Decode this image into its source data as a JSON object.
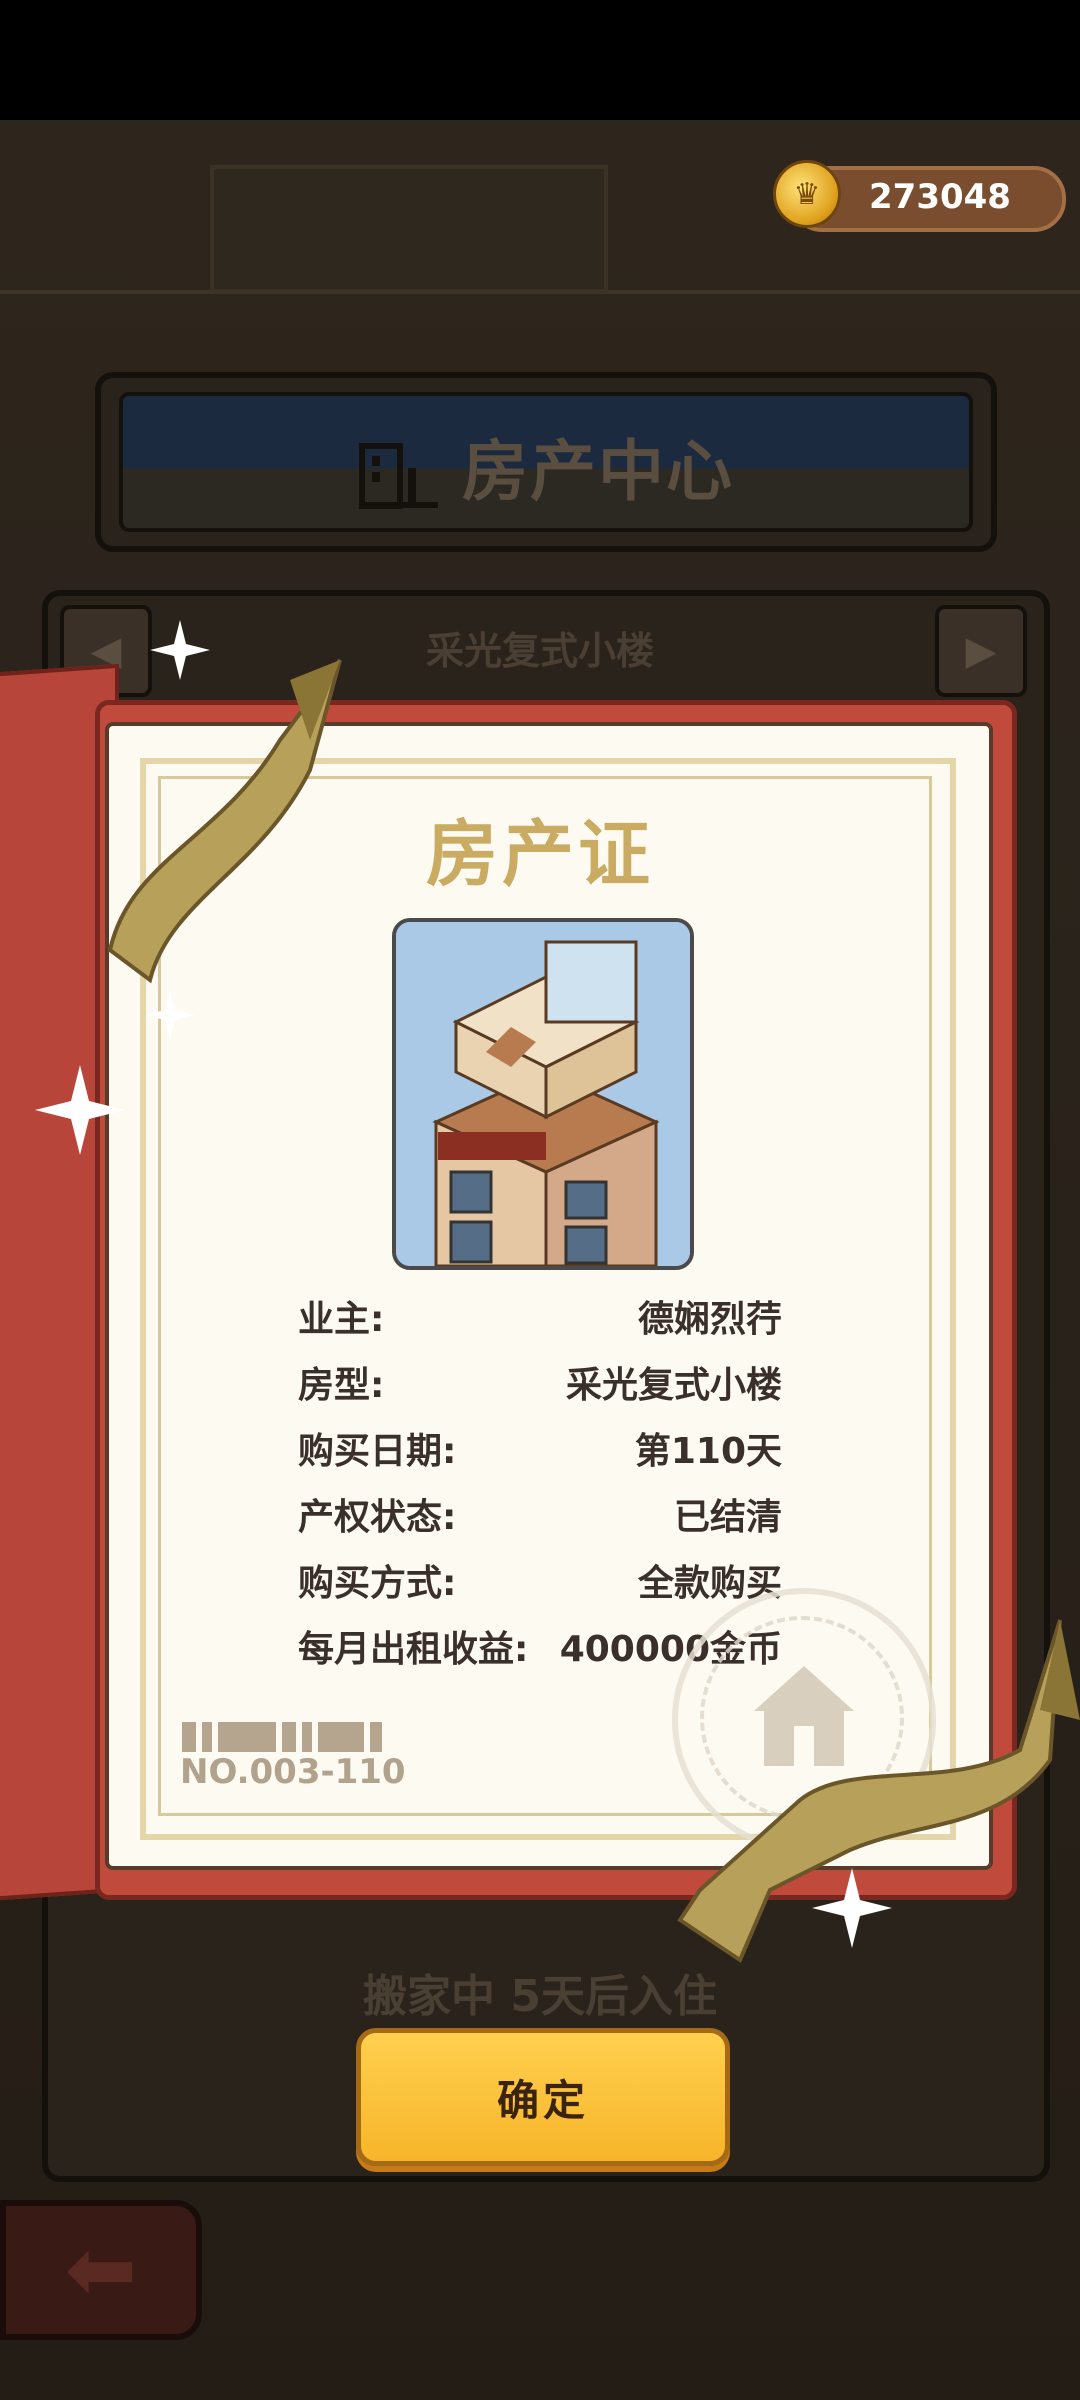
{
  "coins": {
    "value": "273048",
    "icon": "crown-coin-icon"
  },
  "header": {
    "title": "房产中心",
    "icon": "building-icon"
  },
  "property_nav": {
    "name": "采光复式小楼",
    "prev_icon": "arrow-left-icon",
    "next_icon": "arrow-right-icon"
  },
  "certificate": {
    "title": "房产证",
    "rows": [
      {
        "label": "业主:",
        "value": "德娴烈荇"
      },
      {
        "label": "房型:",
        "value": "采光复式小楼"
      },
      {
        "label": "购买日期:",
        "value": "第110天"
      },
      {
        "label": "产权状态:",
        "value": "已结清"
      },
      {
        "label": "购买方式:",
        "value": "全款购买"
      },
      {
        "label": "每月出租收益:",
        "value": "400000金币"
      }
    ],
    "number": "NO.003-110",
    "stamp_icon": "house-stamp-icon"
  },
  "status": {
    "moving": "搬家中 5天后入住"
  },
  "confirm_label": "确定",
  "back_icon": "back-arrow-icon",
  "colors": {
    "accent_gold": "#c9ac62",
    "cover_red": "#c04a3c",
    "button_yellow": "#ffd04e"
  }
}
